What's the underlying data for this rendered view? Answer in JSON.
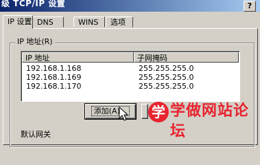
{
  "window": {
    "title": "级 TCP/IP 设置",
    "help_label": "?"
  },
  "tabs": [
    {
      "label": "IP 设置"
    },
    {
      "label": "DNS"
    },
    {
      "label": "WINS"
    },
    {
      "label": "选项"
    }
  ],
  "ip_group": {
    "label": "IP 地址(R)",
    "columns": [
      "IP 地址",
      "子网掩码"
    ],
    "rows": [
      [
        "192.168.1.168",
        "255.255.255.0"
      ],
      [
        "192.168.1.169",
        "255.255.255.0"
      ],
      [
        "192.168.1.170",
        "255.255.255.0"
      ]
    ],
    "add_button": "添加(A)..."
  },
  "watermark": {
    "icon_char": "学",
    "text": "学做网站论坛"
  },
  "gateway_label": "默认网关"
}
